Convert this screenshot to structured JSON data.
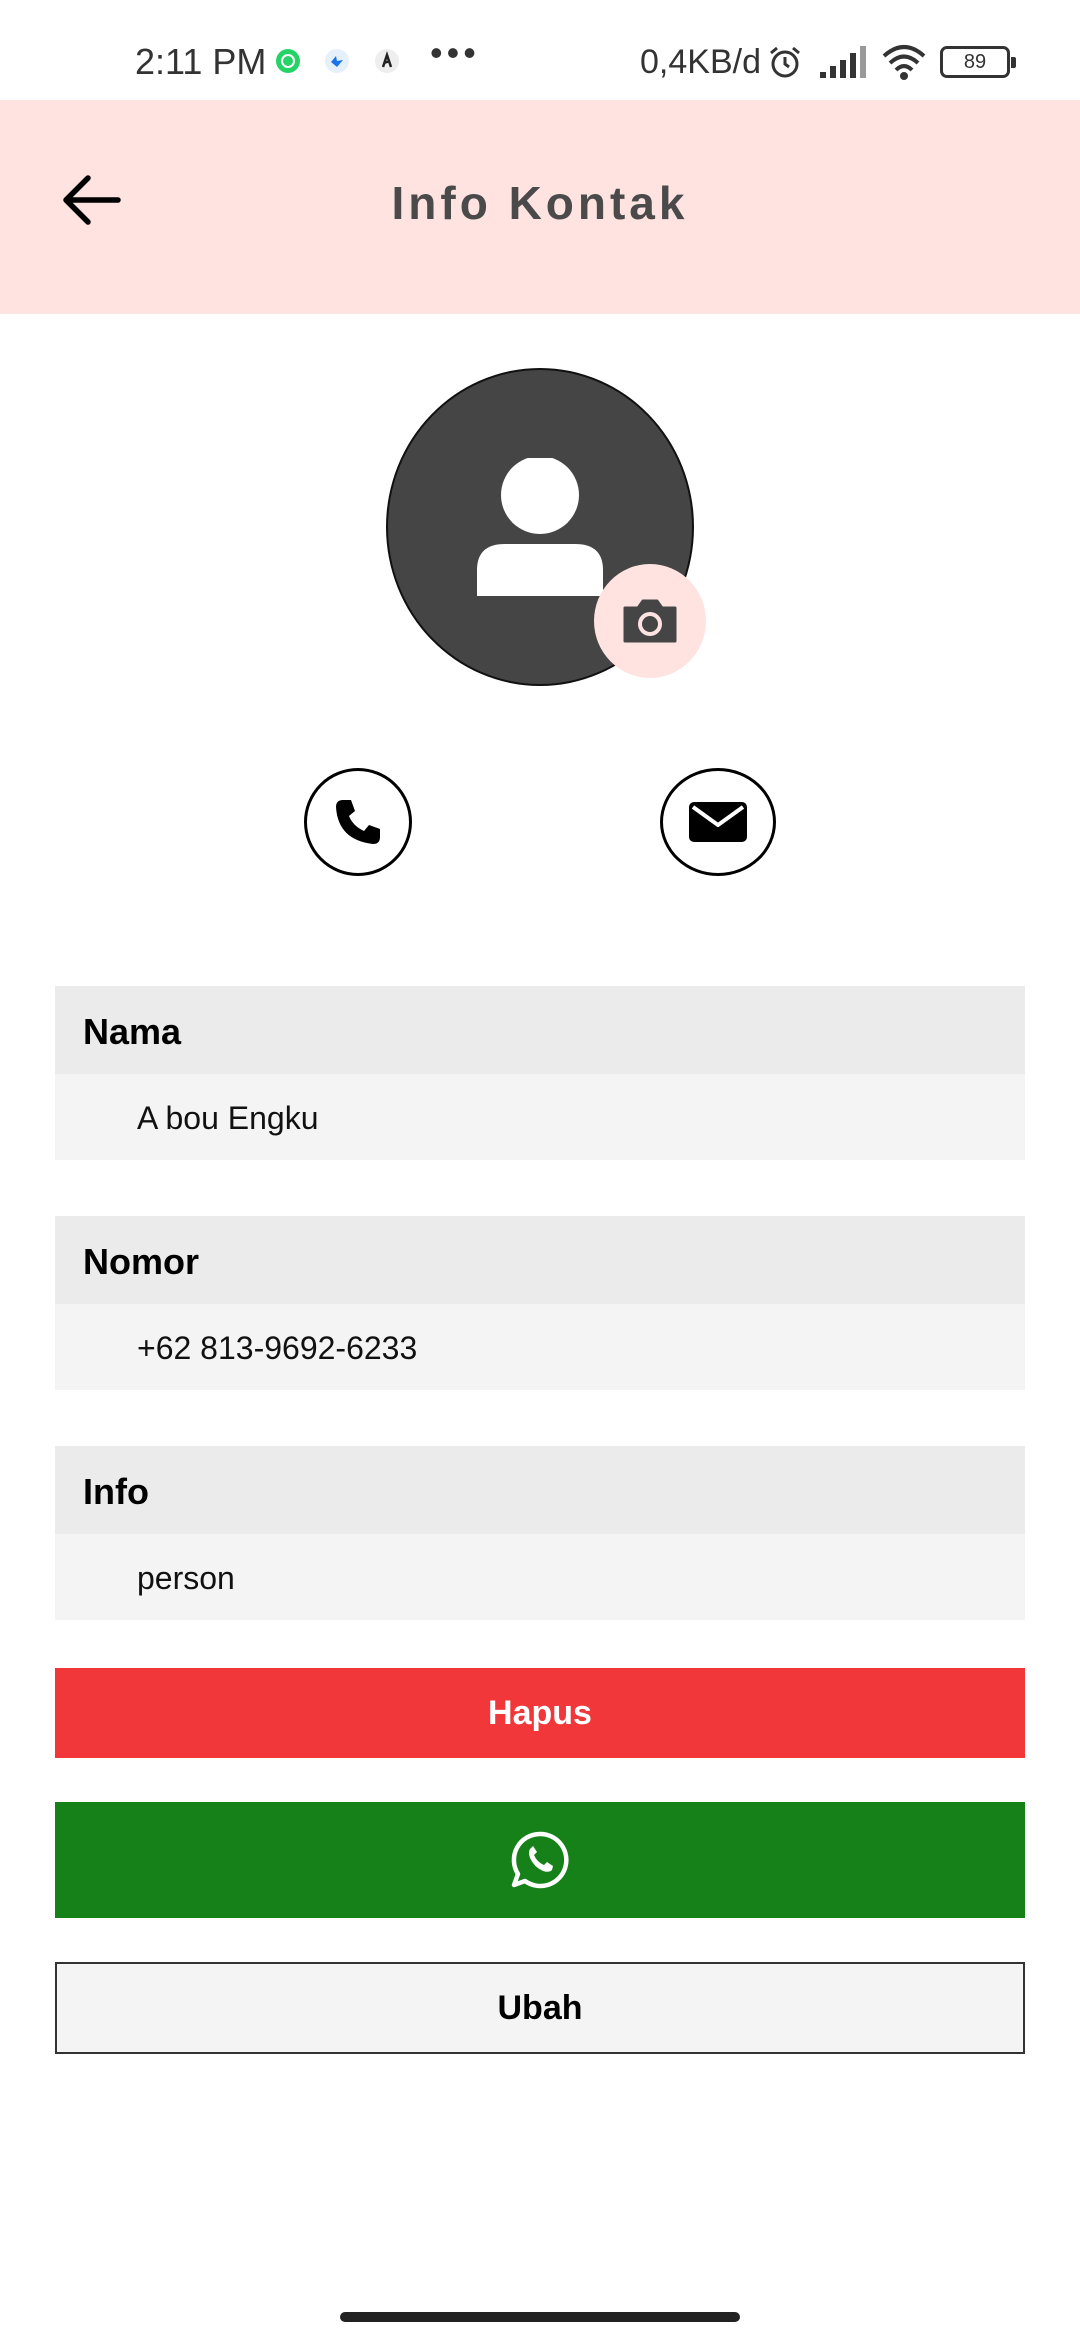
{
  "status_bar": {
    "time": "2:11 PM",
    "notification_icons": [
      "whatsapp-icon",
      "app-notification-icon",
      "app-notification-icon-2"
    ],
    "more_indicator": "•••",
    "network_speed": "0,4KB/d",
    "battery": "89",
    "icons": [
      "alarm-icon",
      "signal-icon",
      "wifi-icon",
      "battery-icon"
    ]
  },
  "app_bar": {
    "title": "Info Kontak",
    "back_icon": "arrow-left-icon",
    "background": "#ffe3e1"
  },
  "avatar": {
    "icon": "person-icon",
    "camera_icon": "camera-icon"
  },
  "actions": {
    "call_icon": "phone-icon",
    "mail_icon": "mail-icon"
  },
  "fields": [
    {
      "label": "Nama",
      "value": "A bou Engku"
    },
    {
      "label": "Nomor",
      "value": "+62 813-9692-6233"
    },
    {
      "label": "Info",
      "value": "person"
    }
  ],
  "buttons": {
    "delete_label": "Hapus",
    "whatsapp_icon": "whatsapp-icon",
    "edit_label": "Ubah"
  },
  "colors": {
    "delete": "#f2373a",
    "whatsapp": "#168119",
    "accent": "#ffe3e1"
  }
}
